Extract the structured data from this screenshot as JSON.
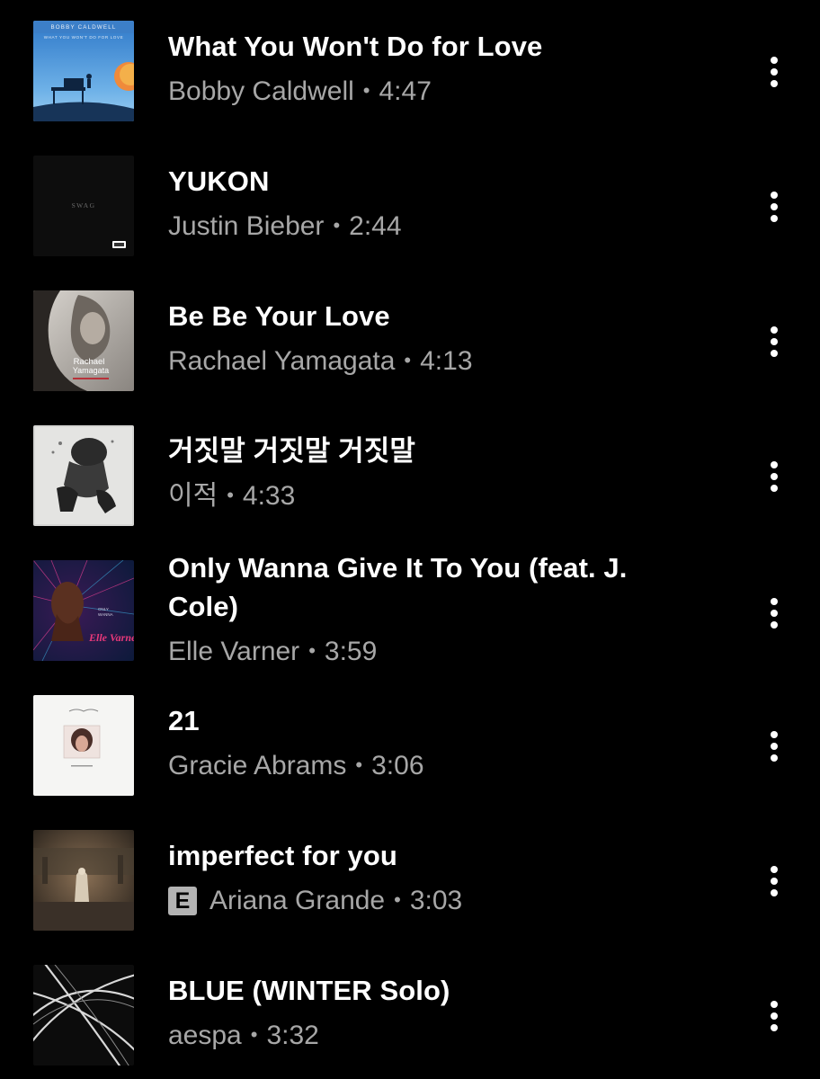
{
  "colors": {
    "background": "#000000",
    "title_text": "#ffffff",
    "secondary_text": "#a7a7a7",
    "explicit_badge": "#b3b3b3"
  },
  "separator": "•",
  "tracks": [
    {
      "title": "What You Won't Do for Love",
      "artist": "Bobby Caldwell",
      "duration": "4:47",
      "explicit": false,
      "art_text": "BOBBY CALDWELL",
      "art_subtext": "WHAT YOU WON'T DO FOR LOVE",
      "more_icon": "more-vertical-icon"
    },
    {
      "title": "YUKON",
      "artist": "Justin Bieber",
      "duration": "2:44",
      "explicit": false,
      "art_text": "SWAG",
      "more_icon": "more-vertical-icon"
    },
    {
      "title": "Be Be Your Love",
      "artist": "Rachael Yamagata",
      "duration": "4:13",
      "explicit": false,
      "art_text": "Rachael Yamagata",
      "more_icon": "more-vertical-icon"
    },
    {
      "title": "거짓말 거짓말 거짓말",
      "artist": "이적",
      "duration": "4:33",
      "explicit": false,
      "more_icon": "more-vertical-icon"
    },
    {
      "title": "Only Wanna Give It To You (feat. J. Cole)",
      "artist": "Elle Varner",
      "duration": "3:59",
      "explicit": false,
      "art_text": "Elle Varner",
      "more_icon": "more-vertical-icon"
    },
    {
      "title": "21",
      "artist": "Gracie Abrams",
      "duration": "3:06",
      "explicit": false,
      "more_icon": "more-vertical-icon"
    },
    {
      "title": "imperfect for you",
      "artist": "Ariana Grande",
      "duration": "3:03",
      "explicit": true,
      "explicit_label": "E",
      "more_icon": "more-vertical-icon"
    },
    {
      "title": "BLUE (WINTER Solo)",
      "artist": "aespa",
      "duration": "3:32",
      "explicit": false,
      "more_icon": "more-vertical-icon"
    }
  ]
}
